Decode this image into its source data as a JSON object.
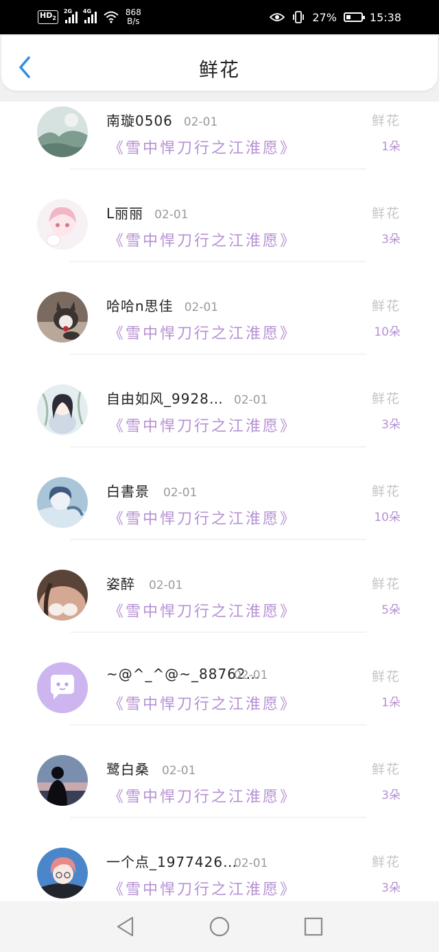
{
  "status_bar": {
    "hd": "HD",
    "hd_sub": "2",
    "net1": "2G",
    "net2": "4G",
    "speed_value": "868",
    "speed_unit": "B/s",
    "battery": "27%",
    "time": "15:38"
  },
  "header": {
    "title": "鲜花"
  },
  "colors": {
    "accent": "#b590d3",
    "back_icon": "#2f8de4"
  },
  "items": [
    {
      "name": "南璇0506",
      "date": "02-01",
      "book": "《雪中悍刀行之江淮愿》",
      "gift": "鲜花",
      "count": "1朵",
      "avatar": "landscape-avatar"
    },
    {
      "name": "L丽丽",
      "date": "02-01",
      "book": "《雪中悍刀行之江淮愿》",
      "gift": "鲜花",
      "count": "3朵",
      "avatar": "anime-girl-avatar"
    },
    {
      "name": "哈哈n思佳",
      "date": "02-01",
      "book": "《雪中悍刀行之江淮愿》",
      "gift": "鲜花",
      "count": "10朵",
      "avatar": "cat-avatar"
    },
    {
      "name": "自由如风_9928…",
      "date": "02-01",
      "book": "《雪中悍刀行之江淮愿》",
      "gift": "鲜花",
      "count": "3朵",
      "avatar": "anime-girl-avatar"
    },
    {
      "name": "白書景",
      "date": "02-01",
      "book": "《雪中悍刀行之江淮愿》",
      "gift": "鲜花",
      "count": "10朵",
      "avatar": "anime-boy-avatar"
    },
    {
      "name": "姿醉",
      "date": "02-01",
      "book": "《雪中悍刀行之江淮愿》",
      "gift": "鲜花",
      "count": "5朵",
      "avatar": "photo-avatar"
    },
    {
      "name": "~@^_^@~_88762…",
      "date": "02-01",
      "book": "《雪中悍刀行之江淮愿》",
      "gift": "鲜花",
      "count": "1朵",
      "avatar": "default-chat-avatar"
    },
    {
      "name": "鹭白桑",
      "date": "02-01",
      "book": "《雪中悍刀行之江淮愿》",
      "gift": "鲜花",
      "count": "3朵",
      "avatar": "silhouette-avatar"
    },
    {
      "name": "一个点_1977426…",
      "date": "02-01",
      "book": "《雪中悍刀行之江淮愿》",
      "gift": "鲜花",
      "count": "3朵",
      "avatar": "anime-girl-avatar"
    }
  ]
}
